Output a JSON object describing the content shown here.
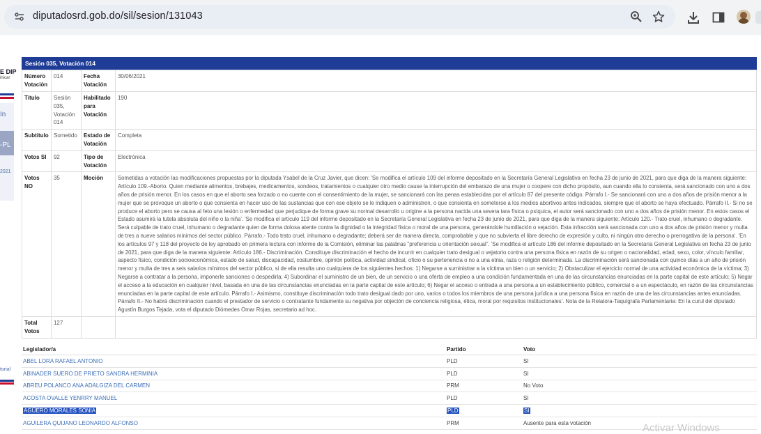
{
  "browser": {
    "url": "diputadosrd.gob.do/sil/sesion/131043"
  },
  "background": {
    "logo_text": "E DIP",
    "logo_sub": "inicar",
    "left_texts": [
      "In",
      "-PL",
      "2021",
      "torial"
    ]
  },
  "card": {
    "header": "Sesión 035, Votación 014",
    "rows": {
      "numero_label": "Número Votación",
      "numero_value": "014",
      "fecha_label": "Fecha Votación",
      "fecha_value": "30/06/2021",
      "titulo_label": "Título",
      "titulo_value": "Sesión 035, Votación 014",
      "habilitado_label": "Habilitado para Votación",
      "habilitado_value": "190",
      "subtitulo_label": "Subtítulo",
      "subtitulo_value": "Sometido",
      "estado_label": "Estado de Votación",
      "estado_value": "Completa",
      "votos_si_label": "Votos SI",
      "votos_si_value": "92",
      "tipo_label": "Tipo de Votación",
      "tipo_value": "Electrónica",
      "votos_no_label": "Votos NO",
      "votos_no_value": "35",
      "mocion_label": "Moción",
      "mocion_value": "Sometidas a votación las modificaciones propuestas por la diputada Ysabel de la Cruz Javier, que dicen: 'Se modifica el artículo 109 del informe depositado en la Secretaría General Legislativa en fecha 23 de junio de 2021, para que diga de la manera siguiente: Artículo 109.-Aborto. Quien mediante alimentos, brebajes, medicamentos, sondeos, tratamientos o cualquier otro medio cause la interrupción del embarazo de una mujer o coopere con dicho propósito, aun cuando ella lo consienta, será sancionado con uno a dos años de prisión menor. En los casos en que el aborto sea forzado o no cuente con el consentimiento de la mujer, se sancionará con las penas establecidas por el artículo 87 del presente código. Párrafo I.- Se sancionará con uno a dos años de prisión menor a la mujer que se provoque un aborto o que consienta en hacer uso de las sustancias que con ese objeto se le indiquen o administren, o que consienta en someterse a los medios abortivos antes indicados, siempre que el aborto se haya efectuado. Párrafo II.- Si no se produce el aborto pero se causa al feto una lesión o enfermedad que perjudique de forma grave su normal desarrollo u origine a la persona nacida una severa tara física o psíquica, el autor será sancionado con uno a dos años de prisión menor. En estos casos el Estado asumirá la tutela absoluta del niño o la niña'. 'Se modifica el artículo 119 del informe depositado en la Secretaría General Legislativa en fecha 23 de junio de 2021, para que diga de la manera siguiente: Artículo 120.- Trato cruel, inhumano o degradante. Será culpable de trato cruel, inhumano o degradante quien de forma dolosa atente contra la dignidad o la integridad física o moral de una persona, generándole humillación o vejación. Esta infracción será sancionada con uno a dos años de prisión menor y multa de tres a nueve salarios mínimos del sector público. Párrafo.- Todo trato cruel, inhumano o degradante; deberá ser de manera directa, comprobable y que no subvierta el libre derecho de expresión y culto, ni ningún otro derecho o prerrogativa de la persona'. 'En los artículos 97 y 118 del proyecto de ley aprobado en primera lectura con informe de la Comisión, eliminar las palabras \"preferencia u orientación sexual\". 'Se modifica el artículo 186 del informe depositado en la Secretaría General Legislativa en fecha 23 de junio de 2021, para que diga de la manera siguiente: Artículo 186.- Discriminación. Constituye discriminación el hecho de incurrir en cualquier trato desigual o vejatorio contra una persona física en razón de su origen o nacionalidad, edad, sexo, color, vínculo familiar, aspecto físico, condición socioeconómica, estado de salud, discapacidad, costumbre, opinión política, actividad sindical, oficio o su pertenencia o no a una etnia, raza o religión determinada. La discriminación será sancionada con quince días a un año de prisión menor y multa de tres a seis salarios mínimos del sector público, si de ella resulta uno cualquiera de los siguientes hechos: 1) Negarse a suministrar a la víctima un bien o un servicio; 2) Obstaculizar el ejercicio normal de una actividad económica de la víctima; 3) Negarse a contratar a la persona, imponerle sanciones o despedirla; 4) Subordinar el suministro de un bien, de un servicio o una oferta de empleo a una condición fundamentada en una de las circunstancias enunciadas en la parte capital de este artículo; 5) Negar el acceso a la educación en cualquier nivel, basada en una de las circunstancias enunciadas en la parte capital de este artículo; 6) Negar el acceso o entrada a una persona a un establecimiento público, comercial o a un espectáculo, en razón de las circunstancias enunciadas en la parte capital de este artículo. Párrafo I.- Asimismo, constituye discriminación todo trato desigual dado por uno, varios o todos los miembros de una persona jurídica a una persona física en razón de una de las circunstancias antes enunciadas. Párrafo II.- No habrá discriminación cuando el prestador de servicio o contratante fundamente su negativa por objeción de conciencia religiosa, ética, moral por requisitos institucionales'. Nota de la Relatora-Taquígrafa Parlamentaria: En la curul del diputado Agustín Burgos Tejada, vota el diputado Diómedes Omar Rojas, secretario ad hoc.",
      "total_label": "Total Votos",
      "total_value": "127"
    }
  },
  "legislators": {
    "headers": {
      "name": "Legislador/a",
      "party": "Partido",
      "vote": "Voto"
    },
    "rows": [
      {
        "name": "ABEL LORA RAFAEL ANTONIO",
        "party": "PLD",
        "vote": "SI"
      },
      {
        "name": "ABINADER SUERO DE PRIETO SANDRA HERMINIA",
        "party": "PLD",
        "vote": "SI"
      },
      {
        "name": "ABREU POLANCO ANA ADALGIZA DEL CARMEN",
        "party": "PRM",
        "vote": "No Voto"
      },
      {
        "name": "ACOSTA OVALLE YENRRY MANUEL",
        "party": "PLD",
        "vote": "SI"
      },
      {
        "name": "AGÜERO MORALES SONIA",
        "party": "PLD",
        "vote": "SI"
      },
      {
        "name": "AGUILERA QUIJANO LEONARDO ALFONSO",
        "party": "PRM",
        "vote": "Ausente para esta votación"
      }
    ]
  },
  "watermark": "Activar Windows",
  "colors": {
    "header_blue": "#1f3c96",
    "link_blue": "#3d6fb8",
    "selection": "#1f4fbf"
  }
}
